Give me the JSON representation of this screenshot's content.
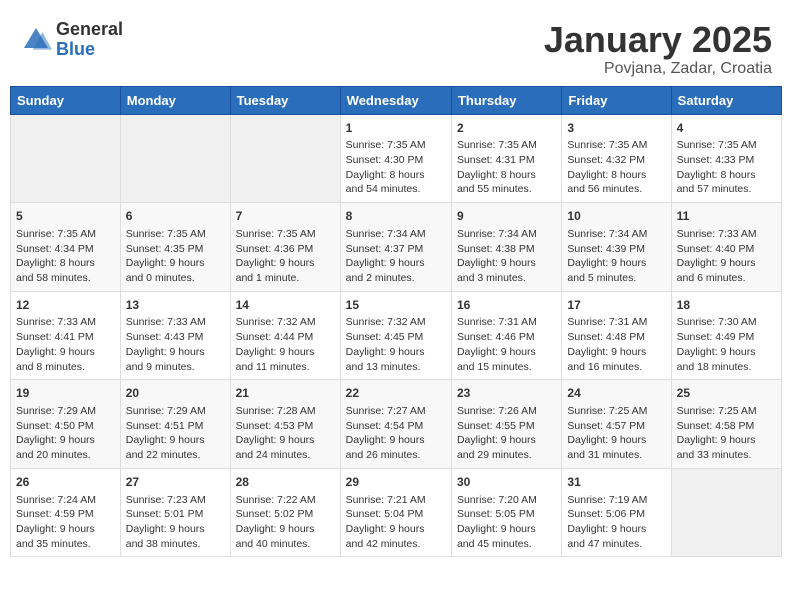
{
  "header": {
    "logo_general": "General",
    "logo_blue": "Blue",
    "month_title": "January 2025",
    "location": "Povjana, Zadar, Croatia"
  },
  "days_of_week": [
    "Sunday",
    "Monday",
    "Tuesday",
    "Wednesday",
    "Thursday",
    "Friday",
    "Saturday"
  ],
  "weeks": [
    [
      {
        "day": "",
        "content": ""
      },
      {
        "day": "",
        "content": ""
      },
      {
        "day": "",
        "content": ""
      },
      {
        "day": "1",
        "content": "Sunrise: 7:35 AM\nSunset: 4:30 PM\nDaylight: 8 hours\nand 54 minutes."
      },
      {
        "day": "2",
        "content": "Sunrise: 7:35 AM\nSunset: 4:31 PM\nDaylight: 8 hours\nand 55 minutes."
      },
      {
        "day": "3",
        "content": "Sunrise: 7:35 AM\nSunset: 4:32 PM\nDaylight: 8 hours\nand 56 minutes."
      },
      {
        "day": "4",
        "content": "Sunrise: 7:35 AM\nSunset: 4:33 PM\nDaylight: 8 hours\nand 57 minutes."
      }
    ],
    [
      {
        "day": "5",
        "content": "Sunrise: 7:35 AM\nSunset: 4:34 PM\nDaylight: 8 hours\nand 58 minutes."
      },
      {
        "day": "6",
        "content": "Sunrise: 7:35 AM\nSunset: 4:35 PM\nDaylight: 9 hours\nand 0 minutes."
      },
      {
        "day": "7",
        "content": "Sunrise: 7:35 AM\nSunset: 4:36 PM\nDaylight: 9 hours\nand 1 minute."
      },
      {
        "day": "8",
        "content": "Sunrise: 7:34 AM\nSunset: 4:37 PM\nDaylight: 9 hours\nand 2 minutes."
      },
      {
        "day": "9",
        "content": "Sunrise: 7:34 AM\nSunset: 4:38 PM\nDaylight: 9 hours\nand 3 minutes."
      },
      {
        "day": "10",
        "content": "Sunrise: 7:34 AM\nSunset: 4:39 PM\nDaylight: 9 hours\nand 5 minutes."
      },
      {
        "day": "11",
        "content": "Sunrise: 7:33 AM\nSunset: 4:40 PM\nDaylight: 9 hours\nand 6 minutes."
      }
    ],
    [
      {
        "day": "12",
        "content": "Sunrise: 7:33 AM\nSunset: 4:41 PM\nDaylight: 9 hours\nand 8 minutes."
      },
      {
        "day": "13",
        "content": "Sunrise: 7:33 AM\nSunset: 4:43 PM\nDaylight: 9 hours\nand 9 minutes."
      },
      {
        "day": "14",
        "content": "Sunrise: 7:32 AM\nSunset: 4:44 PM\nDaylight: 9 hours\nand 11 minutes."
      },
      {
        "day": "15",
        "content": "Sunrise: 7:32 AM\nSunset: 4:45 PM\nDaylight: 9 hours\nand 13 minutes."
      },
      {
        "day": "16",
        "content": "Sunrise: 7:31 AM\nSunset: 4:46 PM\nDaylight: 9 hours\nand 15 minutes."
      },
      {
        "day": "17",
        "content": "Sunrise: 7:31 AM\nSunset: 4:48 PM\nDaylight: 9 hours\nand 16 minutes."
      },
      {
        "day": "18",
        "content": "Sunrise: 7:30 AM\nSunset: 4:49 PM\nDaylight: 9 hours\nand 18 minutes."
      }
    ],
    [
      {
        "day": "19",
        "content": "Sunrise: 7:29 AM\nSunset: 4:50 PM\nDaylight: 9 hours\nand 20 minutes."
      },
      {
        "day": "20",
        "content": "Sunrise: 7:29 AM\nSunset: 4:51 PM\nDaylight: 9 hours\nand 22 minutes."
      },
      {
        "day": "21",
        "content": "Sunrise: 7:28 AM\nSunset: 4:53 PM\nDaylight: 9 hours\nand 24 minutes."
      },
      {
        "day": "22",
        "content": "Sunrise: 7:27 AM\nSunset: 4:54 PM\nDaylight: 9 hours\nand 26 minutes."
      },
      {
        "day": "23",
        "content": "Sunrise: 7:26 AM\nSunset: 4:55 PM\nDaylight: 9 hours\nand 29 minutes."
      },
      {
        "day": "24",
        "content": "Sunrise: 7:25 AM\nSunset: 4:57 PM\nDaylight: 9 hours\nand 31 minutes."
      },
      {
        "day": "25",
        "content": "Sunrise: 7:25 AM\nSunset: 4:58 PM\nDaylight: 9 hours\nand 33 minutes."
      }
    ],
    [
      {
        "day": "26",
        "content": "Sunrise: 7:24 AM\nSunset: 4:59 PM\nDaylight: 9 hours\nand 35 minutes."
      },
      {
        "day": "27",
        "content": "Sunrise: 7:23 AM\nSunset: 5:01 PM\nDaylight: 9 hours\nand 38 minutes."
      },
      {
        "day": "28",
        "content": "Sunrise: 7:22 AM\nSunset: 5:02 PM\nDaylight: 9 hours\nand 40 minutes."
      },
      {
        "day": "29",
        "content": "Sunrise: 7:21 AM\nSunset: 5:04 PM\nDaylight: 9 hours\nand 42 minutes."
      },
      {
        "day": "30",
        "content": "Sunrise: 7:20 AM\nSunset: 5:05 PM\nDaylight: 9 hours\nand 45 minutes."
      },
      {
        "day": "31",
        "content": "Sunrise: 7:19 AM\nSunset: 5:06 PM\nDaylight: 9 hours\nand 47 minutes."
      },
      {
        "day": "",
        "content": ""
      }
    ]
  ]
}
